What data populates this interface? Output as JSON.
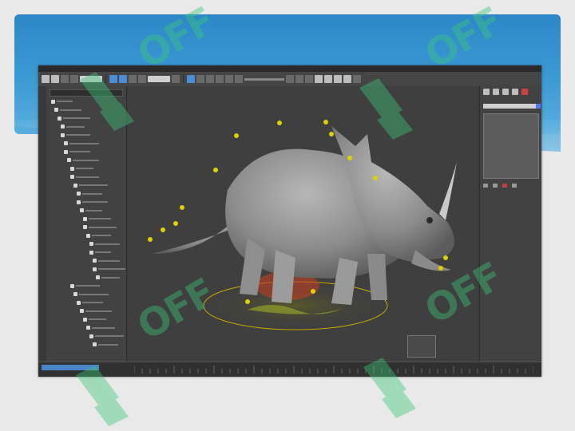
{
  "slide": {
    "banner_color": "#3d9ad4"
  },
  "app": {
    "theme_color": "#3b3b3b",
    "toolbar": {
      "icons": [
        "undo-icon",
        "redo-icon",
        "link-icon",
        "unlink-icon",
        "select-icon",
        "move-icon",
        "rotate-icon",
        "scale-icon",
        "snap-icon",
        "mirror-icon",
        "align-icon",
        "render-setup-icon",
        "render-icon",
        "material-editor-icon"
      ]
    },
    "scene_explorer": {
      "search_placeholder": ""
    },
    "viewport": {
      "label": "",
      "info_lines": [
        "",
        ""
      ]
    },
    "command_panel": {
      "object_name": ""
    },
    "timeline": {
      "slider_label": ""
    }
  },
  "watermark": {
    "text": "OFF",
    "color": "#3cc878"
  }
}
